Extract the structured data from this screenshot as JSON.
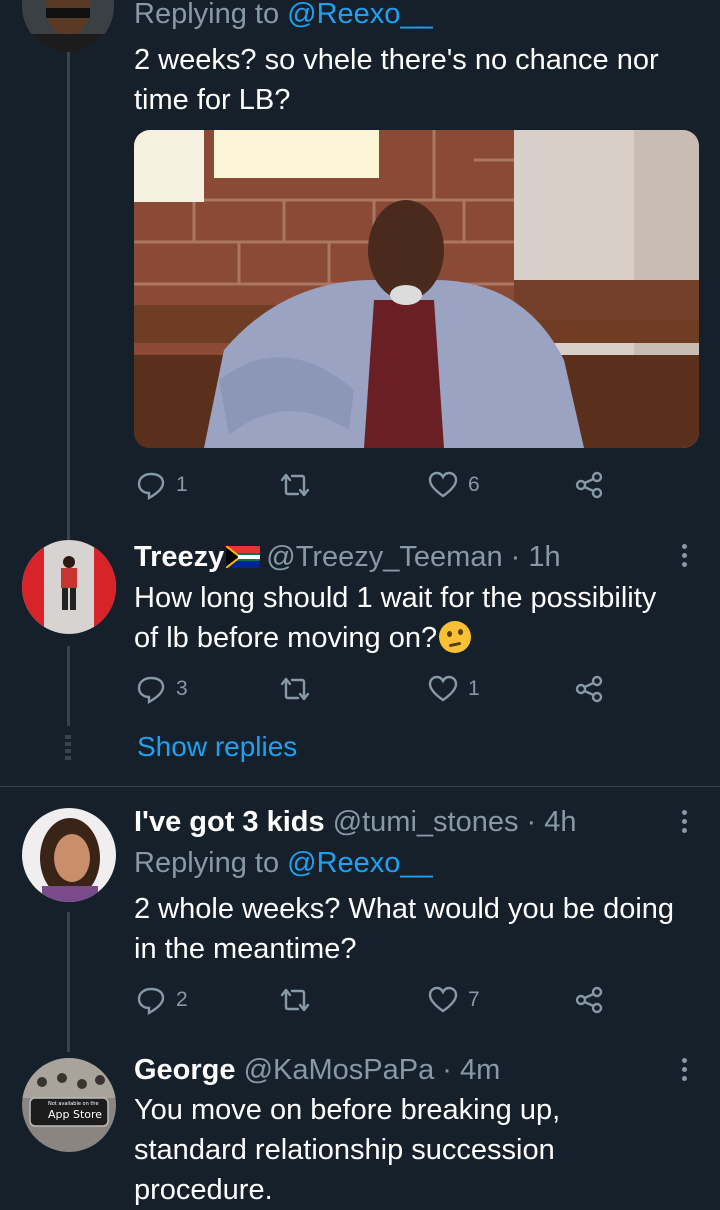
{
  "tweets": [
    {
      "replying_prefix": "Replying to",
      "replying_handle": "@Reexo__",
      "text": "2 weeks? so vhele there's no chance nor time for LB?",
      "text_line1": "2 weeks? so vhele there's no chance nor",
      "text_line2": "time for LB?",
      "reply_count": "1",
      "like_count": "6"
    },
    {
      "display_name": "Treezy",
      "handle": "@Treezy_Teeman",
      "time": "· 1h",
      "text_line1": "How long should 1 wait for the possibility",
      "text_line2": "of lb before moving on?",
      "reply_count": "3",
      "like_count": "1",
      "show_replies": "Show replies"
    },
    {
      "display_name": "I've got 3 kids",
      "handle": "@tumi_stones",
      "time": "· 4h",
      "replying_prefix": "Replying to",
      "replying_handle": "@Reexo__",
      "text_line1": "2 whole weeks? What would you be doing",
      "text_line2": "in the meantime?",
      "reply_count": "2",
      "like_count": "7"
    },
    {
      "display_name": "George",
      "handle": "@KaMosPaPa",
      "time": "· 4m",
      "text_line1": "You move on before breaking up,",
      "text_line2": "standard relationship succession",
      "text_line3": "procedure.",
      "avatar_badge_small": "Not available on the",
      "avatar_badge_large": "App Store"
    }
  ],
  "icons": [
    "reply-icon",
    "retweet-icon",
    "like-icon",
    "share-icon",
    "more-icon",
    "thinking-face-emoji",
    "south-africa-flag-emoji"
  ],
  "colors": {
    "background": "#15202b",
    "link": "#1da1f2",
    "muted": "#8899a6",
    "divider": "#38444d"
  }
}
